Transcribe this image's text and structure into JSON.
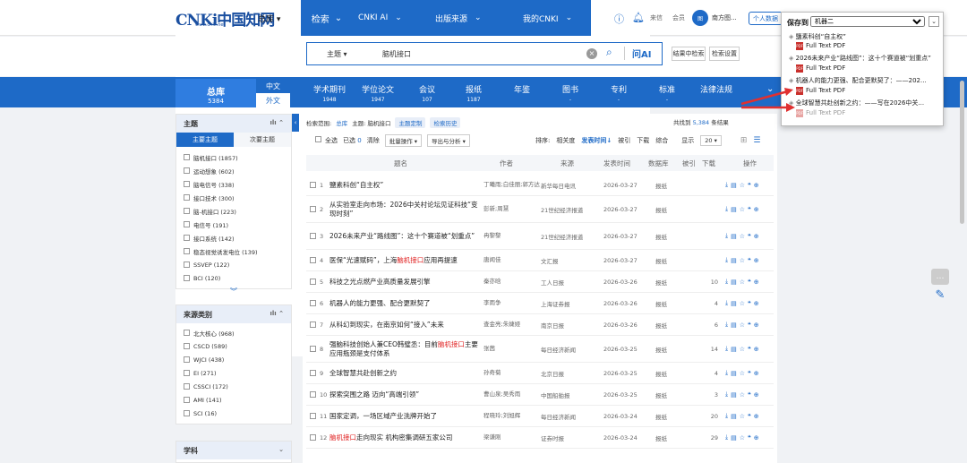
{
  "header": {
    "logo_text": "CNKi中国知网",
    "logo_sub": "www.cnki.net",
    "nav": [
      {
        "label": "总库"
      },
      {
        "label": "检索"
      },
      {
        "label": "CNKI AI"
      },
      {
        "label": "出版来源"
      },
      {
        "label": "我的CNKI"
      }
    ],
    "links": {
      "tousu": "来信",
      "member": "会员"
    },
    "user_name": "南方图...",
    "user_button": "个人数据"
  },
  "search": {
    "field": "主题",
    "query": "脑机接口",
    "ai_label": "问AI",
    "btn_in_results": "结果中检索",
    "btn_settings": "检索设置"
  },
  "dbbar": {
    "total_label": "总库",
    "total_count": "5384",
    "lang_cn": "中文",
    "lang_en": "外文",
    "items": [
      {
        "label": "学术期刊",
        "count": "1948"
      },
      {
        "label": "学位论文",
        "count": "1947"
      },
      {
        "label": "会议",
        "count": "107"
      },
      {
        "label": "报纸",
        "count": "1187"
      },
      {
        "label": "年鉴",
        "count": ""
      },
      {
        "label": "图书",
        "count": "-"
      },
      {
        "label": "专利",
        "count": "-"
      },
      {
        "label": "标准",
        "count": "-"
      },
      {
        "label": "法律法规",
        "count": ""
      }
    ]
  },
  "sidebar": {
    "topic": {
      "title": "主题",
      "tabs": [
        "主要主题",
        "次要主题"
      ],
      "items": [
        "脑机接口 (1857)",
        "运动想象 (602)",
        "脑电信号 (338)",
        "接口技术 (300)",
        "脑-机接口 (223)",
        "电信号 (191)",
        "接口系统 (142)",
        "稳态视觉诱发电位 (139)",
        "SSVEP (122)",
        "BCI (120)"
      ]
    },
    "source": {
      "title": "来源类别",
      "items": [
        "北大核心 (968)",
        "CSCD (589)",
        "WJCI (438)",
        "EI (271)",
        "CSSCI (172)",
        "AMI (141)",
        "SCI (16)"
      ]
    },
    "subject": {
      "title": "学科"
    }
  },
  "results": {
    "crumb_label": "检索范围:",
    "crumb_scope": "总库",
    "crumb_topic": "主题: 脑机接口",
    "crumb_btn1": "主题定制",
    "crumb_btn2": "检索历史",
    "found_label": "共找到",
    "found_count": "5,384",
    "found_suffix": "条结果",
    "select_all": "全选",
    "selected": "已选",
    "selected_count": "0",
    "clear": "清除",
    "batch": "批量操作",
    "export": "导出与分析",
    "sort_label": "排序:",
    "sort_options": [
      "相关度",
      "发表时间",
      "被引",
      "下载",
      "综合"
    ],
    "show_label": "显示",
    "show_count": "20",
    "headers": [
      "题名",
      "作者",
      "来源",
      "发表时间",
      "数据库",
      "被引",
      "下载",
      "操作"
    ],
    "rows": [
      {
        "no": "1",
        "title": "鹽素科创“自主权”",
        "hl": "",
        "title2": "",
        "author": "丁曦雨;白佳丽;郭方达",
        "source": "新华每日电讯",
        "date": "2026-03-27",
        "db": "报纸",
        "cite": "",
        "dl": ""
      },
      {
        "no": "2",
        "title": "从实验室走向市场：2026中关村论坛见证科技“变现时刻”",
        "hl": "",
        "title2": "",
        "author": "彭新;周慧",
        "source": "21世纪经济报道",
        "date": "2026-03-27",
        "db": "报纸",
        "cite": "",
        "dl": ""
      },
      {
        "no": "3",
        "title": "2026未来产业“路线图”：这十个赛道被“划重点”",
        "hl": "",
        "title2": "",
        "author": "冉黎黎",
        "source": "21世纪经济报道",
        "date": "2026-03-27",
        "db": "报纸",
        "cite": "",
        "dl": ""
      },
      {
        "no": "4",
        "title": "医保“光速赋码”，上海",
        "hl": "脑机接口",
        "title2": "应用再提速",
        "author": "唐闻佳",
        "source": "文汇报",
        "date": "2026-03-27",
        "db": "报纸",
        "cite": "",
        "dl": ""
      },
      {
        "no": "5",
        "title": "科技之光点燃产业高质量发展引擎",
        "hl": "",
        "title2": "",
        "author": "秦亦晗",
        "source": "工人日报",
        "date": "2026-03-26",
        "db": "报纸",
        "cite": "",
        "dl": "10"
      },
      {
        "no": "6",
        "title": "机器人的能力更强、配合更默契了",
        "hl": "",
        "title2": "",
        "author": "李雨争",
        "source": "上海证券报",
        "date": "2026-03-26",
        "db": "报纸",
        "cite": "",
        "dl": "4"
      },
      {
        "no": "7",
        "title": "从科幻到现实，在南京如何“接入”未来",
        "hl": "",
        "title2": "",
        "author": "查金亮;朱婕娅",
        "source": "南京日报",
        "date": "2026-03-26",
        "db": "报纸",
        "cite": "",
        "dl": "6"
      },
      {
        "no": "8",
        "title": "强脑科技创始人兼CEO韩璧丞：目前",
        "hl": "脑机接口",
        "title2": "主要应用瓶颈是支付体系",
        "author": "张茜",
        "source": "每日经济新闻",
        "date": "2026-03-25",
        "db": "报纸",
        "cite": "",
        "dl": "14"
      },
      {
        "no": "9",
        "title": "全球智慧共赴创新之约",
        "hl": "",
        "title2": "",
        "author": "孙奇菊",
        "source": "北京日报",
        "date": "2026-03-25",
        "db": "报纸",
        "cite": "",
        "dl": "4"
      },
      {
        "no": "10",
        "title": "探索突围之路 迈向“高端引领”",
        "hl": "",
        "title2": "",
        "author": "曹山泉;吴秀雨",
        "source": "中国船舶报",
        "date": "2026-03-25",
        "db": "报纸",
        "cite": "",
        "dl": "3"
      },
      {
        "no": "11",
        "title": "国家定调，一场区域产业洗牌开始了",
        "hl": "",
        "title2": "",
        "author": "程晓玲;刘旭辉",
        "source": "每日经济新闻",
        "date": "2026-03-24",
        "db": "报纸",
        "cite": "",
        "dl": "20"
      },
      {
        "no": "12",
        "title": "",
        "hl": "脑机接口",
        "title2": "走向现实 机构密集调研五家公司",
        "author": "梁谦刚",
        "source": "证券时报",
        "date": "2026-03-24",
        "db": "报纸",
        "cite": "",
        "dl": "29"
      }
    ]
  },
  "popup": {
    "label": "保存到",
    "folder": "机器二",
    "items": [
      {
        "title": "鹽素科创“自主权”",
        "pdf": "Full Text PDF"
      },
      {
        "title": "2026未来产业“路线图”：这十个赛道被“划重点”",
        "pdf": "Full Text PDF"
      },
      {
        "title": "机器人的能力更强、配合更默契了：——202...",
        "pdf": "Full Text PDF"
      },
      {
        "title": "全球智慧共赴创新之约：——写在2026中关...",
        "pdf": "Full Text PDF"
      }
    ]
  },
  "colors": {
    "brand": "#1e6ac7",
    "highlight": "#e02020"
  }
}
